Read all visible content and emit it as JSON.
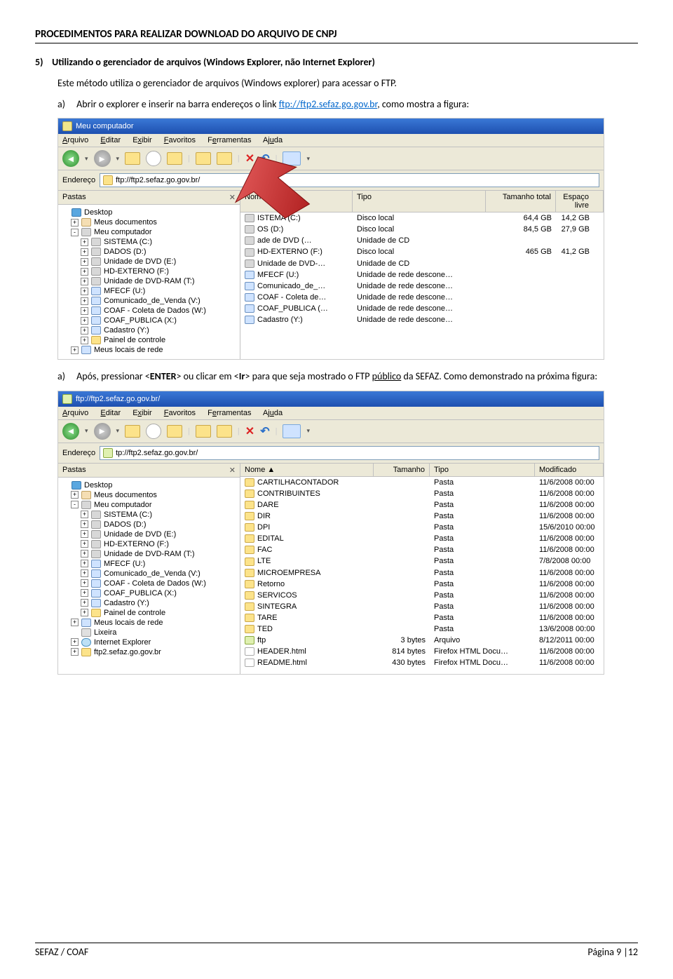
{
  "doc_title": "PROCEDIMENTOS PARA REALIZAR DOWNLOAD DO ARQUIVO DE CNPJ",
  "section_num": "5)",
  "section_title": "Utilizando o gerenciador de arquivos (Windows Explorer, não Internet Explorer)",
  "intro": "Este método utiliza o gerenciador de arquivos (Windows explorer) para acessar o FTP.",
  "step_a_marker": "a)",
  "step_a_pre": "Abrir o explorer e inserir na barra endereços o link ",
  "step_a_link": "ftp://ftp2.sefaz.go.gov.br",
  "step_a_post": ", como mostra a figura:",
  "step_b_marker": "a)",
  "step_b_text_1": "Após, pressionar <",
  "step_b_enter": "ENTER",
  "step_b_text_2": "> ou clicar em <",
  "step_b_ir": "Ir",
  "step_b_text_3": "> para que seja mostrado o FTP ",
  "step_b_publico": "público",
  "step_b_text_4": " da SEFAZ. Como demonstrado na próxima figura:",
  "shot1": {
    "title": "Meu computador",
    "menu": {
      "arquivo": "Arquivo",
      "editar": "Editar",
      "exibir": "Exibir",
      "favoritos": "Favoritos",
      "ferramentas": "Ferramentas",
      "ajuda": "Ajuda"
    },
    "addr_label": "Endereço",
    "addr_value": "ftp://ftp2.sefaz.go.gov.br/",
    "panes_label": "Pastas",
    "tree": [
      {
        "pad": 0,
        "icon": "desk",
        "text": "Desktop"
      },
      {
        "pad": 1,
        "pm": "+",
        "icon": "docs",
        "text": "Meus documentos"
      },
      {
        "pad": 1,
        "pm": "-",
        "icon": "drive",
        "text": "Meu computador"
      },
      {
        "pad": 2,
        "pm": "+",
        "icon": "drive",
        "text": "SISTEMA (C:)"
      },
      {
        "pad": 2,
        "pm": "+",
        "icon": "drive",
        "text": "DADOS (D:)"
      },
      {
        "pad": 2,
        "pm": "+",
        "icon": "drive",
        "text": "Unidade de DVD (E:)"
      },
      {
        "pad": 2,
        "pm": "+",
        "icon": "drive",
        "text": "HD-EXTERNO (F:)"
      },
      {
        "pad": 2,
        "pm": "+",
        "icon": "drive",
        "text": "Unidade de DVD-RAM (T:)"
      },
      {
        "pad": 2,
        "pm": "+",
        "icon": "net",
        "text": "MFECF (U:)"
      },
      {
        "pad": 2,
        "pm": "+",
        "icon": "net",
        "text": "Comunicado_de_Venda (V:)"
      },
      {
        "pad": 2,
        "pm": "+",
        "icon": "net",
        "text": "COAF - Coleta de Dados (W:)"
      },
      {
        "pad": 2,
        "pm": "+",
        "icon": "net",
        "text": "COAF_PUBLICA (X:)"
      },
      {
        "pad": 2,
        "pm": "+",
        "icon": "net",
        "text": "Cadastro (Y:)"
      },
      {
        "pad": 2,
        "pm": "+",
        "icon": "folder",
        "text": "Painel de controle"
      },
      {
        "pad": 1,
        "pm": "+",
        "icon": "net",
        "text": "Meus locais de rede"
      }
    ],
    "list_hdr": {
      "c1": "Nome  ▲",
      "c2": "Tipo",
      "c3": "Tamanho total",
      "c4": "Espaço livre"
    },
    "list_rows": [
      {
        "icon": "drive",
        "name": "ISTEMA (C:)",
        "type": "Disco local",
        "size": "64,4 GB",
        "free": "14,2 GB"
      },
      {
        "icon": "drive",
        "name": "OS (D:)",
        "type": "Disco local",
        "size": "84,5 GB",
        "free": "27,9 GB"
      },
      {
        "icon": "drive",
        "name": "ade de DVD (…",
        "type": "Unidade de CD",
        "size": "",
        "free": ""
      },
      {
        "icon": "drive",
        "name": "HD-EXTERNO (F:)",
        "type": "Disco local",
        "size": "465 GB",
        "free": "41,2 GB"
      },
      {
        "icon": "drive",
        "name": "Unidade de DVD-…",
        "type": "Unidade de CD",
        "size": "",
        "free": ""
      },
      {
        "icon": "net",
        "name": "MFECF (U:)",
        "type": "Unidade de rede descone…",
        "size": "",
        "free": ""
      },
      {
        "icon": "net",
        "name": "Comunicado_de_…",
        "type": "Unidade de rede descone…",
        "size": "",
        "free": ""
      },
      {
        "icon": "net",
        "name": "COAF - Coleta de…",
        "type": "Unidade de rede descone…",
        "size": "",
        "free": ""
      },
      {
        "icon": "net",
        "name": "COAF_PUBLICA (…",
        "type": "Unidade de rede descone…",
        "size": "",
        "free": ""
      },
      {
        "icon": "net",
        "name": "Cadastro (Y:)",
        "type": "Unidade de rede descone…",
        "size": "",
        "free": ""
      }
    ]
  },
  "shot2": {
    "title": "ftp://ftp2.sefaz.go.gov.br/",
    "menu": {
      "arquivo": "Arquivo",
      "editar": "Editar",
      "exibir": "Exibir",
      "favoritos": "Favoritos",
      "ferramentas": "Ferramentas",
      "ajuda": "Ajuda"
    },
    "addr_label": "Endereço",
    "addr_value": "tp://ftp2.sefaz.go.gov.br/",
    "panes_label": "Pastas",
    "tree": [
      {
        "pad": 0,
        "icon": "desk",
        "text": "Desktop"
      },
      {
        "pad": 1,
        "pm": "+",
        "icon": "docs",
        "text": "Meus documentos"
      },
      {
        "pad": 1,
        "pm": "-",
        "icon": "drive",
        "text": "Meu computador"
      },
      {
        "pad": 2,
        "pm": "+",
        "icon": "drive",
        "text": "SISTEMA (C:)"
      },
      {
        "pad": 2,
        "pm": "+",
        "icon": "drive",
        "text": "DADOS (D:)"
      },
      {
        "pad": 2,
        "pm": "+",
        "icon": "drive",
        "text": "Unidade de DVD (E:)"
      },
      {
        "pad": 2,
        "pm": "+",
        "icon": "drive",
        "text": "HD-EXTERNO (F:)"
      },
      {
        "pad": 2,
        "pm": "+",
        "icon": "drive",
        "text": "Unidade de DVD-RAM (T:)"
      },
      {
        "pad": 2,
        "pm": "+",
        "icon": "net",
        "text": "MFECF (U:)"
      },
      {
        "pad": 2,
        "pm": "+",
        "icon": "net",
        "text": "Comunicado_de_Venda (V:)"
      },
      {
        "pad": 2,
        "pm": "+",
        "icon": "net",
        "text": "COAF - Coleta de Dados (W:)"
      },
      {
        "pad": 2,
        "pm": "+",
        "icon": "net",
        "text": "COAF_PUBLICA (X:)"
      },
      {
        "pad": 2,
        "pm": "+",
        "icon": "net",
        "text": "Cadastro (Y:)"
      },
      {
        "pad": 2,
        "pm": "+",
        "icon": "folder",
        "text": "Painel de controle"
      },
      {
        "pad": 1,
        "pm": "+",
        "icon": "net",
        "text": "Meus locais de rede"
      },
      {
        "pad": 1,
        "icon": "trash",
        "text": "Lixeira"
      },
      {
        "pad": 1,
        "pm": "+",
        "icon": "ie",
        "text": "Internet Explorer"
      },
      {
        "pad": 1,
        "pm": "+",
        "icon": "ftp",
        "text": "ftp2.sefaz.go.gov.br"
      }
    ],
    "list_hdr": {
      "c1": "Nome  ▲",
      "c2": "Tamanho",
      "c3": "Tipo",
      "c4": "Modificado"
    },
    "list_rows": [
      {
        "icon": "folder",
        "name": "CARTILHACONTADOR",
        "size": "",
        "type": "Pasta",
        "mod": "11/6/2008 00:00"
      },
      {
        "icon": "folder",
        "name": "CONTRIBUINTES",
        "size": "",
        "type": "Pasta",
        "mod": "11/6/2008 00:00"
      },
      {
        "icon": "folder",
        "name": "DARE",
        "size": "",
        "type": "Pasta",
        "mod": "11/6/2008 00:00"
      },
      {
        "icon": "folder",
        "name": "DIR",
        "size": "",
        "type": "Pasta",
        "mod": "11/6/2008 00:00"
      },
      {
        "icon": "folder",
        "name": "DPI",
        "size": "",
        "type": "Pasta",
        "mod": "15/6/2010 00:00"
      },
      {
        "icon": "folder",
        "name": "EDITAL",
        "size": "",
        "type": "Pasta",
        "mod": "11/6/2008 00:00"
      },
      {
        "icon": "folder",
        "name": "FAC",
        "size": "",
        "type": "Pasta",
        "mod": "11/6/2008 00:00"
      },
      {
        "icon": "folder",
        "name": "LTE",
        "size": "",
        "type": "Pasta",
        "mod": "7/8/2008 00:00"
      },
      {
        "icon": "folder",
        "name": "MICROEMPRESA",
        "size": "",
        "type": "Pasta",
        "mod": "11/6/2008 00:00"
      },
      {
        "icon": "folder",
        "name": "Retorno",
        "size": "",
        "type": "Pasta",
        "mod": "11/6/2008 00:00"
      },
      {
        "icon": "folder",
        "name": "SERVICOS",
        "size": "",
        "type": "Pasta",
        "mod": "11/6/2008 00:00"
      },
      {
        "icon": "folder",
        "name": "SINTEGRA",
        "size": "",
        "type": "Pasta",
        "mod": "11/6/2008 00:00"
      },
      {
        "icon": "folder",
        "name": "TARE",
        "size": "",
        "type": "Pasta",
        "mod": "11/6/2008 00:00"
      },
      {
        "icon": "folder",
        "name": "TED",
        "size": "",
        "type": "Pasta",
        "mod": "13/6/2008 00:00"
      },
      {
        "icon": "ftp",
        "name": "ftp",
        "size": "3 bytes",
        "type": "Arquivo",
        "mod": "8/12/2011 00:00"
      },
      {
        "icon": "file",
        "name": "HEADER.html",
        "size": "814 bytes",
        "type": "Firefox HTML Docu…",
        "mod": "11/6/2008 00:00"
      },
      {
        "icon": "file",
        "name": "README.html",
        "size": "430 bytes",
        "type": "Firefox HTML Docu…",
        "mod": "11/6/2008 00:00"
      }
    ]
  },
  "footer_left": "SEFAZ / COAF",
  "footer_right": "Página 9 |12"
}
